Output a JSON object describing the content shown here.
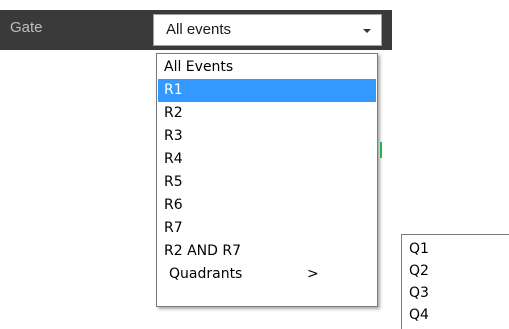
{
  "gate": {
    "label": "Gate",
    "selected_value": "All events"
  },
  "dropdown": {
    "items": [
      {
        "label": "All Events",
        "selected": false
      },
      {
        "label": "R1",
        "selected": true
      },
      {
        "label": "R2",
        "selected": false
      },
      {
        "label": "R3",
        "selected": false
      },
      {
        "label": "R4",
        "selected": false
      },
      {
        "label": "R5",
        "selected": false
      },
      {
        "label": "R6",
        "selected": false
      },
      {
        "label": "R7",
        "selected": false
      },
      {
        "label": "R2 AND R7",
        "selected": false
      }
    ],
    "submenu_item": {
      "label": "Quadrants",
      "arrow": ">"
    }
  },
  "submenu": {
    "items": [
      "Q1",
      "Q2",
      "Q3",
      "Q4"
    ]
  },
  "colors": {
    "bar_background": "#3a3a3a",
    "selection": "#3399ff",
    "accent_green": "#2bb24c"
  },
  "icons": {
    "select_arrow": "chevron-down-icon"
  }
}
